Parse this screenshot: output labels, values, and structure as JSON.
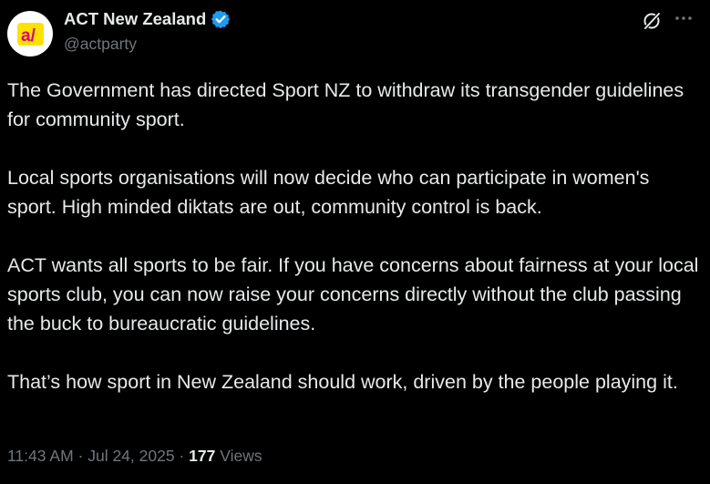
{
  "author": {
    "display_name": "ACT New Zealand",
    "handle": "@actparty",
    "avatar_text": "a/",
    "verified_color": "#1d9bf0",
    "brand_yellow": "#fde200",
    "brand_magenta": "#e0007b",
    "brand_cyan": "#00a7e1"
  },
  "post": {
    "paragraphs": [
      "The Government has directed Sport NZ to withdraw its transgender guidelines for community sport.",
      "Local sports organisations will now decide who can participate in women's sport. High minded diktats are out, community control is back.",
      "ACT wants all sports to be fair. If you have concerns about fairness at your local sports club, you can now raise your concerns directly without the club passing the buck to bureaucratic guidelines.",
      "That’s how sport in New Zealand should work, driven by the people playing it."
    ],
    "time": "11:43 AM",
    "separator": "·",
    "date": "Jul 24, 2025",
    "views_count": "177",
    "views_label": "Views"
  },
  "icons": {
    "grok": "grok-icon",
    "more": "more-icon",
    "verified": "verified-badge-icon"
  }
}
